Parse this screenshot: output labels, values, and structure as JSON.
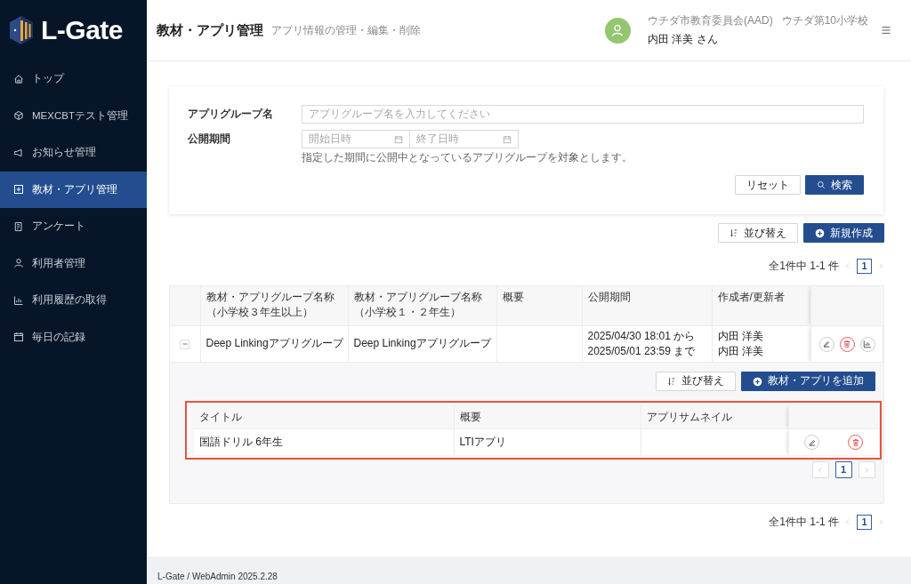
{
  "brand": {
    "name": "L-Gate"
  },
  "sidebar": {
    "items": [
      {
        "label": "トップ",
        "selected": false
      },
      {
        "label": "MEXCBTテスト管理",
        "selected": false
      },
      {
        "label": "お知らせ管理",
        "selected": false
      },
      {
        "label": "教材・アプリ管理",
        "selected": true
      },
      {
        "label": "アンケート",
        "selected": false
      },
      {
        "label": "利用者管理",
        "selected": false
      },
      {
        "label": "利用履歴の取得",
        "selected": false
      },
      {
        "label": "毎日の記録",
        "selected": false
      }
    ]
  },
  "header": {
    "title": "教材・アプリ管理",
    "subtitle": "アプリ情報の管理・編集・削除",
    "org": "ウチダ市教育委員会(AAD)",
    "school": "ウチダ第10小学校",
    "user": "内田 洋美 さん"
  },
  "search": {
    "name_label": "アプリグループ名",
    "name_placeholder": "アプリグループ名を入力してください",
    "period_label": "公開期間",
    "start_placeholder": "開始日時",
    "end_placeholder": "終了日時",
    "hint": "指定した期間に公開中となっているアプリグループを対象とします。",
    "reset": "リセット",
    "submit": "検索"
  },
  "toolbar": {
    "sort": "並び替え",
    "create": "新規作成"
  },
  "pager_top": {
    "summary": "全1件中 1-1 件",
    "pages": [
      {
        "label": "1",
        "selected": true
      }
    ]
  },
  "groups": {
    "columns": [
      [
        "教材・アプリグループ名称",
        "（小学校３年生以上）"
      ],
      [
        "教材・アプリグループ名称",
        "（小学校１・２年生）"
      ],
      [
        "概要"
      ],
      [
        "公開期間"
      ],
      [
        "作成者/更新者"
      ]
    ],
    "rows": [
      {
        "expanded": true,
        "name_upper": "Deep Linkingアプリグループ",
        "name_lower": "Deep Linkingアプリグループ",
        "period": [
          "2025/04/30 18:01 から",
          "2025/05/01 23:59 まで"
        ],
        "authors": [
          "内田 洋美",
          "内田 洋美"
        ],
        "detail": {
          "sort": "並び替え",
          "add": "教材・アプリを追加",
          "columns": [
            "タイトル",
            "概要",
            "アプリサムネイル"
          ],
          "rows": [
            {
              "title": "国語ドリル 6年生",
              "summary": "LTIアプリ"
            }
          ],
          "pages": [
            {
              "label": "1",
              "selected": true
            }
          ]
        }
      }
    ]
  },
  "pager_bottom": {
    "summary": "全1件中 1-1 件",
    "pages": [
      {
        "label": "1",
        "selected": true
      }
    ]
  },
  "footer": {
    "text": "L-Gate / WebAdmin 2025.2.28"
  }
}
